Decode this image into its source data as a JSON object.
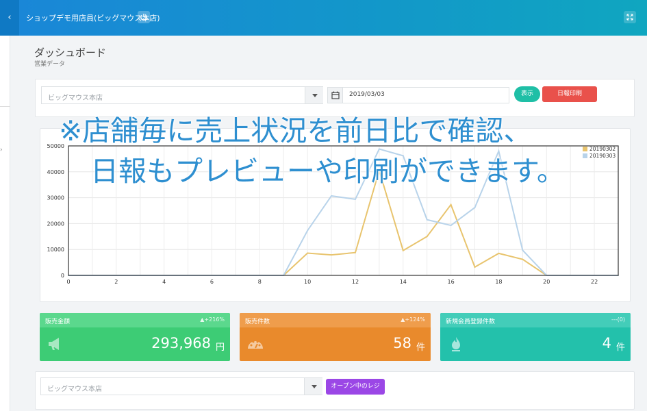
{
  "header": {
    "back_icon": "chevron-left-icon",
    "title": "ショップデモ用店員(ビッグマウス本店)",
    "power_icon": "power-icon",
    "expand_icon": "expand-icon"
  },
  "page": {
    "title": "ダッシュボード",
    "subtitle": "営業データ"
  },
  "filter": {
    "store_placeholder": "ビッグマウス本店",
    "date_value": "2019/03/03",
    "show_button": "表示",
    "print_button": "日報印刷"
  },
  "overlay": {
    "line1": "※店舗毎に売上状況を前日比で確認、",
    "line2": "日報もプレビューや印刷ができます。"
  },
  "chart_data": {
    "type": "line",
    "x": [
      0,
      1,
      2,
      3,
      4,
      5,
      6,
      7,
      8,
      9,
      10,
      11,
      12,
      13,
      14,
      15,
      16,
      17,
      18,
      19,
      20,
      21,
      22,
      23
    ],
    "xlim": [
      0,
      23
    ],
    "ylim": [
      0,
      50000
    ],
    "xticks": [
      "0",
      "2",
      "4",
      "6",
      "8",
      "10",
      "12",
      "14",
      "16",
      "18",
      "20",
      "22"
    ],
    "yticks": [
      "0",
      "10000",
      "20000",
      "30000",
      "40000",
      "50000"
    ],
    "legend_position": "top-right",
    "grid": true,
    "series": [
      {
        "name": "20190302",
        "color": "#e8c46e",
        "values": [
          0,
          0,
          0,
          0,
          0,
          0,
          0,
          0,
          0,
          0,
          8600,
          7900,
          8800,
          40500,
          9600,
          15000,
          27300,
          3200,
          8500,
          6200,
          0,
          0,
          0,
          0
        ]
      },
      {
        "name": "20190303",
        "color": "#b8d3ea",
        "values": [
          0,
          0,
          0,
          0,
          0,
          0,
          0,
          0,
          0,
          0,
          17300,
          30700,
          29400,
          48800,
          46200,
          21500,
          19300,
          26200,
          48000,
          9700,
          0,
          0,
          0,
          0
        ]
      }
    ]
  },
  "stats": [
    {
      "label": "販売金額",
      "change": "▲+216%",
      "value": "293,968",
      "unit": "円",
      "color": "#3dcc75",
      "head": "#5bd88d",
      "icon": "megaphone-icon"
    },
    {
      "label": "販売件数",
      "change": "▲+124%",
      "value": "58",
      "unit": "件",
      "color": "#e98a2c",
      "head": "#ef9d4c",
      "icon": "dashboard-gauge-icon"
    },
    {
      "label": "新規会員登録件数",
      "change": "---(0)",
      "value": "4",
      "unit": "件",
      "color": "#23c1ab",
      "head": "#43cdb9",
      "icon": "flame-icon"
    }
  ],
  "register": {
    "store_placeholder": "ビッグマウス本店",
    "open_button": "オープン中のレジ"
  }
}
